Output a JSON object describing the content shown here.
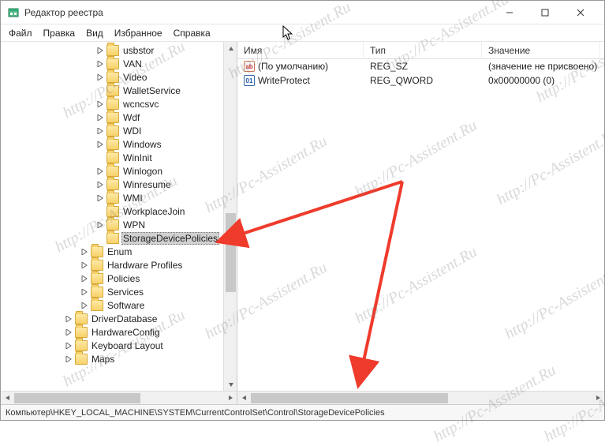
{
  "window": {
    "title": "Редактор реестра"
  },
  "menubar": {
    "file": "Файл",
    "edit": "Правка",
    "view": "Вид",
    "favorites": "Избранное",
    "help": "Справка"
  },
  "tree": {
    "items": [
      {
        "label": "usbstor",
        "indent": 120,
        "expander": "closed"
      },
      {
        "label": "VAN",
        "indent": 120,
        "expander": "closed"
      },
      {
        "label": "Video",
        "indent": 120,
        "expander": "closed"
      },
      {
        "label": "WalletService",
        "indent": 120,
        "expander": "blank"
      },
      {
        "label": "wcncsvc",
        "indent": 120,
        "expander": "closed"
      },
      {
        "label": "Wdf",
        "indent": 120,
        "expander": "closed"
      },
      {
        "label": "WDI",
        "indent": 120,
        "expander": "closed"
      },
      {
        "label": "Windows",
        "indent": 120,
        "expander": "closed"
      },
      {
        "label": "WinInit",
        "indent": 120,
        "expander": "blank"
      },
      {
        "label": "Winlogon",
        "indent": 120,
        "expander": "closed"
      },
      {
        "label": "Winresume",
        "indent": 120,
        "expander": "closed"
      },
      {
        "label": "WMI",
        "indent": 120,
        "expander": "closed"
      },
      {
        "label": "WorkplaceJoin",
        "indent": 120,
        "expander": "blank"
      },
      {
        "label": "WPN",
        "indent": 120,
        "expander": "closed"
      },
      {
        "label": "StorageDevicePolicies",
        "indent": 120,
        "expander": "blank",
        "selected": true
      },
      {
        "label": "Enum",
        "indent": 100,
        "expander": "closed"
      },
      {
        "label": "Hardware Profiles",
        "indent": 100,
        "expander": "closed"
      },
      {
        "label": "Policies",
        "indent": 100,
        "expander": "closed"
      },
      {
        "label": "Services",
        "indent": 100,
        "expander": "closed"
      },
      {
        "label": "Software",
        "indent": 100,
        "expander": "closed"
      },
      {
        "label": "DriverDatabase",
        "indent": 80,
        "expander": "closed"
      },
      {
        "label": "HardwareConfig",
        "indent": 80,
        "expander": "closed"
      },
      {
        "label": "Keyboard Layout",
        "indent": 80,
        "expander": "closed"
      },
      {
        "label": "Maps",
        "indent": 80,
        "expander": "closed"
      }
    ]
  },
  "list": {
    "columns": {
      "name": {
        "label": "Имя",
        "width": 160
      },
      "type": {
        "label": "Тип",
        "width": 150
      },
      "value": {
        "label": "Значение",
        "width": 150
      }
    },
    "rows": [
      {
        "icon": "str",
        "name": "(По умолчанию)",
        "type": "REG_SZ",
        "value": "(значение не присвоено)"
      },
      {
        "icon": "bin",
        "name": "WriteProtect",
        "type": "REG_QWORD",
        "value": "0x00000000 (0)"
      }
    ]
  },
  "statusbar": {
    "path": "Компьютер\\HKEY_LOCAL_MACHINE\\SYSTEM\\CurrentControlSet\\Control\\StorageDevicePolicies"
  },
  "watermark": "http://Pc-Assistent.Ru"
}
